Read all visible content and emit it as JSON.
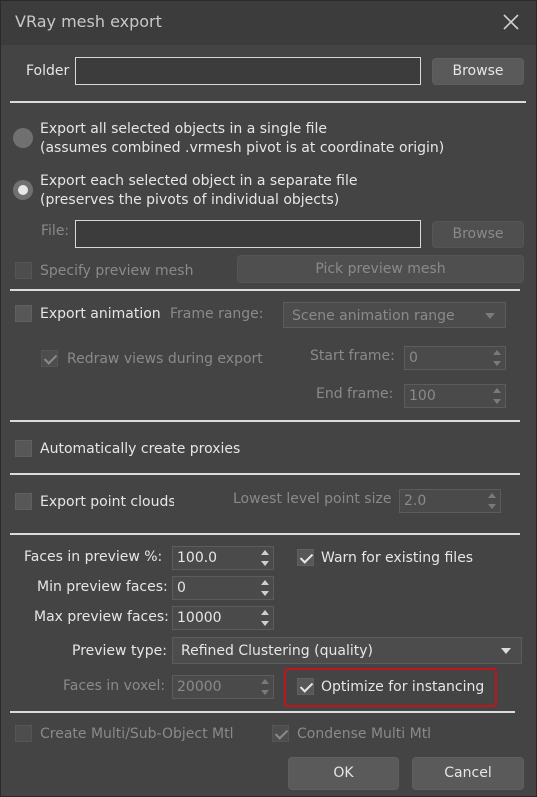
{
  "window": {
    "title": "VRay mesh export"
  },
  "folder": {
    "label": "Folder",
    "value": "",
    "browse_label": "Browse"
  },
  "export_mode": {
    "single_file": {
      "line1": "Export all selected objects in a single file",
      "line2": "(assumes combined .vrmesh pivot is at coordinate origin)",
      "selected": false
    },
    "separate_files": {
      "line1": "Export each selected object in a separate file",
      "line2": "(preserves the pivots of individual objects)",
      "selected": true
    }
  },
  "file": {
    "label": "File:",
    "value": "",
    "browse_label": "Browse"
  },
  "preview_mesh": {
    "checkbox_label": "Specify preview mesh",
    "pick_label": "Pick preview mesh"
  },
  "animation": {
    "checkbox_label": "Export animation",
    "frame_range_label": "Frame range:",
    "frame_range_value": "Scene animation range",
    "redraw_label": "Redraw views during export",
    "start_frame_label": "Start frame:",
    "start_frame_value": "0",
    "end_frame_label": "End frame:",
    "end_frame_value": "100"
  },
  "proxies": {
    "checkbox_label": "Automatically create proxies"
  },
  "point_clouds": {
    "checkbox_label": "Export point clouds",
    "lowest_label": "Lowest level point size",
    "lowest_value": "2.0"
  },
  "preview": {
    "faces_percent_label": "Faces in preview %:",
    "faces_percent_value": "100.0",
    "min_faces_label": "Min preview faces:",
    "min_faces_value": "0",
    "max_faces_label": "Max preview faces:",
    "max_faces_value": "10000",
    "type_label": "Preview type:",
    "type_value": "Refined Clustering (quality)",
    "voxel_label": "Faces in voxel:",
    "voxel_value": "20000",
    "warn_label": "Warn for existing files",
    "optimize_label": "Optimize for instancing"
  },
  "materials": {
    "multi_sub_label": "Create Multi/Sub-Object Mtl",
    "condense_label": "Condense Multi Mtl"
  },
  "footer": {
    "ok_label": "OK",
    "cancel_label": "Cancel"
  },
  "colors": {
    "background": "#444444",
    "titlebar": "#3c3c3c",
    "highlight": "#c0151a"
  }
}
